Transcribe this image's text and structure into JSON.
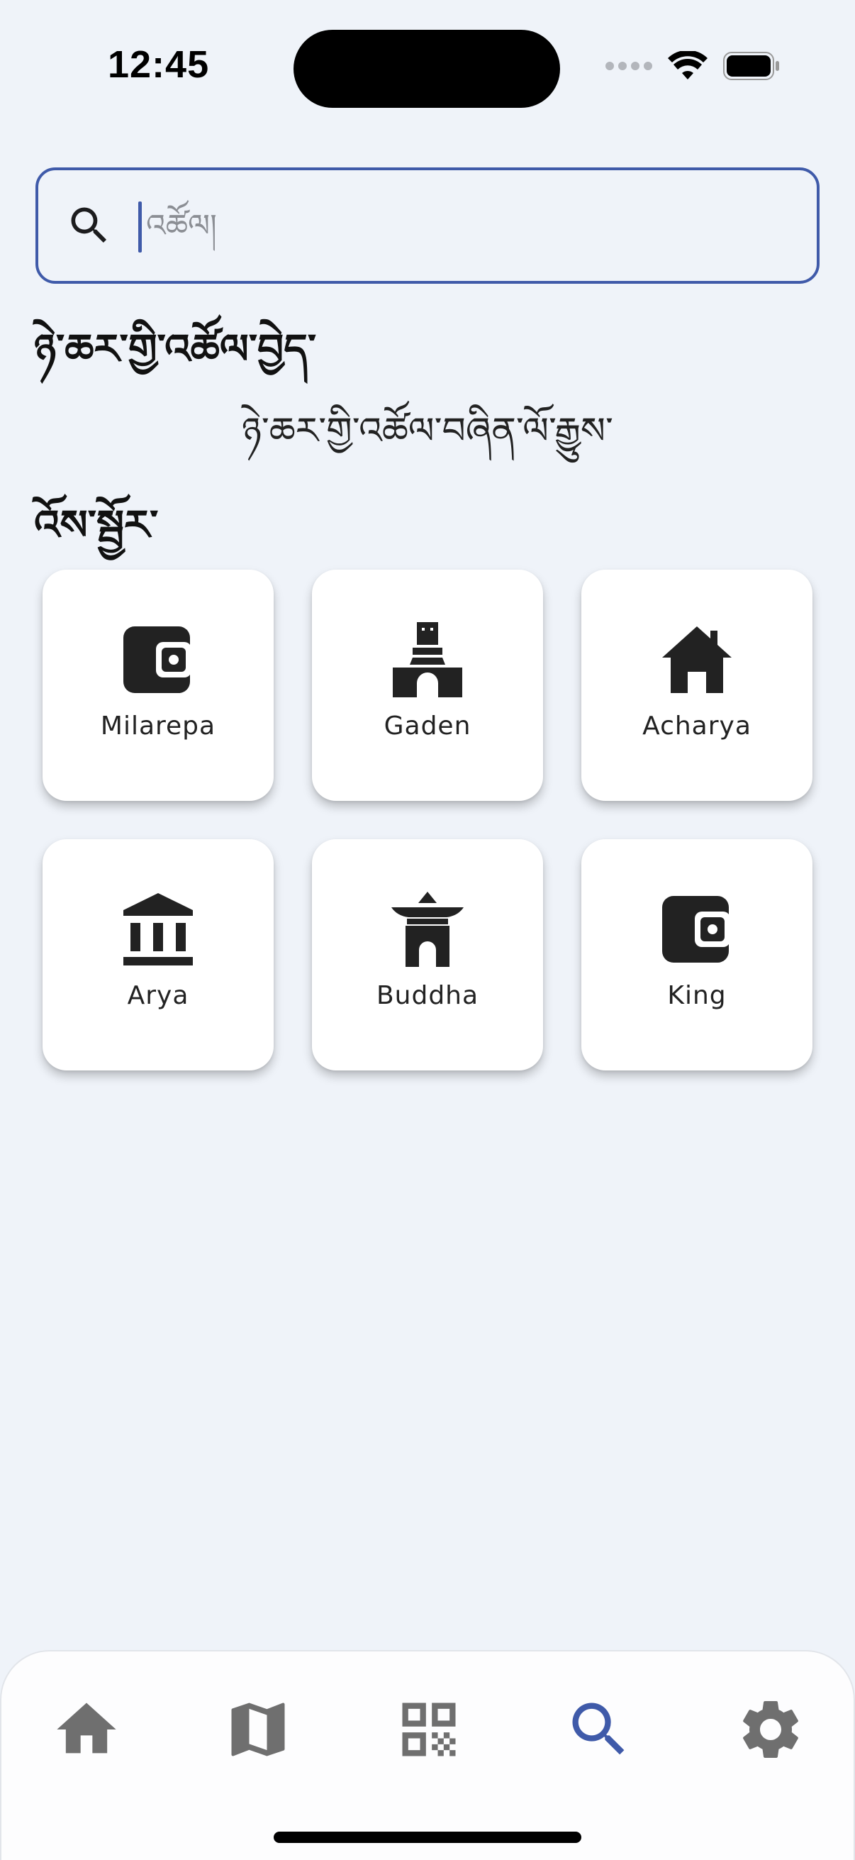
{
  "status_bar": {
    "time": "12:45"
  },
  "search": {
    "placeholder": "འཚོལ།",
    "value": ""
  },
  "sections": {
    "title": "ཉེ་ཆར་གྱི་འཚོལ་བྱེད་",
    "empty_text": "ཉེ་ཆར་གྱི་འཚོལ་བཞིན་ལོ་རྒྱུས་",
    "suggestions_title": "འོས་སྦྱོར་"
  },
  "cards": [
    {
      "label": "Milarepa",
      "icon": "wallet-icon"
    },
    {
      "label": "Gaden",
      "icon": "temple-tower-icon"
    },
    {
      "label": "Acharya",
      "icon": "house-icon"
    },
    {
      "label": "Arya",
      "icon": "bank-icon"
    },
    {
      "label": "Buddha",
      "icon": "pagoda-icon"
    },
    {
      "label": "King",
      "icon": "wallet-icon"
    }
  ],
  "bottom_nav": {
    "items": [
      {
        "icon": "home-icon",
        "active": false
      },
      {
        "icon": "map-icon",
        "active": false
      },
      {
        "icon": "qr-code-icon",
        "active": false
      },
      {
        "icon": "search-icon",
        "active": true
      },
      {
        "icon": "settings-icon",
        "active": false
      }
    ],
    "active_color": "#3f5aa9",
    "inactive_color": "#6f6f6f"
  },
  "colors": {
    "accent": "#3f5aa9",
    "background": "#eff3f9",
    "card": "#ffffff",
    "icon": "#222222"
  }
}
